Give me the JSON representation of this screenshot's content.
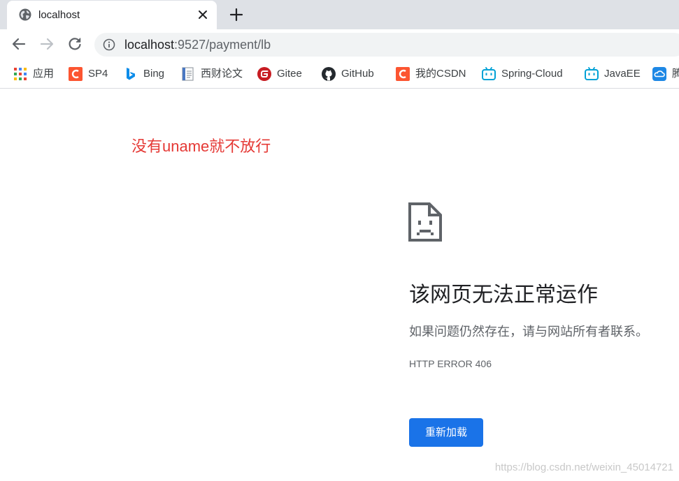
{
  "tab": {
    "title": "localhost"
  },
  "address_bar": {
    "host": "localhost",
    "rest": ":9527/payment/lb"
  },
  "bookmarks": [
    {
      "label": "应用",
      "icon": "apps-grid-icon"
    },
    {
      "label": "SP4",
      "icon": "csdn-icon"
    },
    {
      "label": "Bing",
      "icon": "bing-icon"
    },
    {
      "label": "西财论文",
      "icon": "document-icon"
    },
    {
      "label": "Gitee",
      "icon": "gitee-icon"
    },
    {
      "label": "GitHub",
      "icon": "github-icon"
    },
    {
      "label": "我的CSDN",
      "icon": "csdn-icon"
    },
    {
      "label": "Spring-Cloud",
      "icon": "bilibili-icon"
    },
    {
      "label": "JavaEE",
      "icon": "bilibili-icon"
    },
    {
      "label": "腾",
      "icon": "tencent-cloud-icon"
    }
  ],
  "annotation": "没有uname就不放行",
  "error": {
    "title": "该网页无法正常运作",
    "message": "如果问题仍然存在，请与网站所有者联系。",
    "code": "HTTP ERROR 406",
    "reload_label": "重新加载"
  },
  "watermark": "https://blog.csdn.net/weixin_45014721",
  "colors": {
    "accent": "#1a73e8",
    "annotation": "#e53935",
    "tabstrip": "#dee1e6",
    "omnibox": "#f1f3f4"
  }
}
